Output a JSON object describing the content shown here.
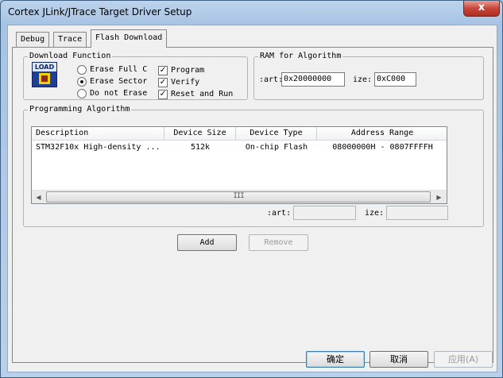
{
  "window": {
    "title": "Cortex JLink/JTrace Target Driver Setup",
    "close_glyph": "x"
  },
  "tabs": [
    {
      "label": "Debug"
    },
    {
      "label": "Trace"
    },
    {
      "label": "Flash Download",
      "active": true
    }
  ],
  "download_function": {
    "title": "Download Function",
    "icon_text": "LOAD",
    "erase_options": [
      {
        "label": "Erase Full C",
        "selected": false
      },
      {
        "label": "Erase Sector",
        "selected": true
      },
      {
        "label": "Do not Erase",
        "selected": false
      }
    ],
    "checks": [
      {
        "label": "Program",
        "checked": true
      },
      {
        "label": "Verify",
        "checked": true
      },
      {
        "label": "Reset and Run",
        "checked": true
      }
    ],
    "check_glyph": "✓"
  },
  "ram_for_algorithm": {
    "title": "RAM for Algorithm",
    "start_label": ":art:",
    "start_value": "0x20000000",
    "size_label": "ize:",
    "size_value": "0xC000"
  },
  "programming_algorithm": {
    "title": "Programming Algorithm",
    "columns": [
      "Description",
      "Device Size",
      "Device Type",
      "Address Range"
    ],
    "rows": [
      {
        "description": "STM32F10x High-density ...",
        "device_size": "512k",
        "device_type": "On-chip Flash",
        "address_range": "08000000H - 0807FFFFH"
      }
    ],
    "scroll_left": "◀",
    "scroll_right": "▶",
    "thumb_grip": "III",
    "start_label": ":art:",
    "start_value": "",
    "size_label": "ize:",
    "size_value": ""
  },
  "buttons": {
    "add": "Add",
    "remove": "Remove"
  },
  "footer": {
    "ok": "确定",
    "cancel": "取消",
    "apply": "应用(A)"
  }
}
